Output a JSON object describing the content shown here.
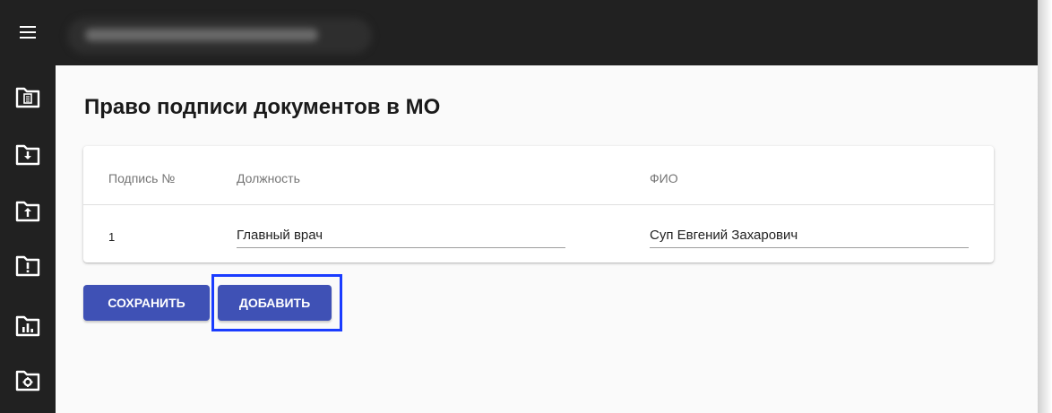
{
  "app": {
    "title_blurred": true
  },
  "sidebar": {
    "items": [
      {
        "icon": "document-folder-icon"
      },
      {
        "icon": "download-folder-icon"
      },
      {
        "icon": "upload-folder-icon"
      },
      {
        "icon": "alert-folder-icon"
      },
      {
        "icon": "report-chart-icon"
      },
      {
        "icon": "settings-folder-icon"
      }
    ]
  },
  "page": {
    "title": "Право подписи документов в МО"
  },
  "table": {
    "headers": {
      "number": "Подпись №",
      "position": "Должность",
      "name": "ФИО"
    },
    "rows": [
      {
        "number": "1",
        "position": "Главный врач",
        "name": "Суп Евгений Захарович"
      }
    ]
  },
  "actions": {
    "save_label": "СОХРАНИТЬ",
    "add_label": "ДОБАВИТЬ"
  },
  "colors": {
    "topbar": "#212121",
    "primary": "#3f51b5",
    "highlight": "#1a3cff",
    "background": "#fafafa"
  }
}
